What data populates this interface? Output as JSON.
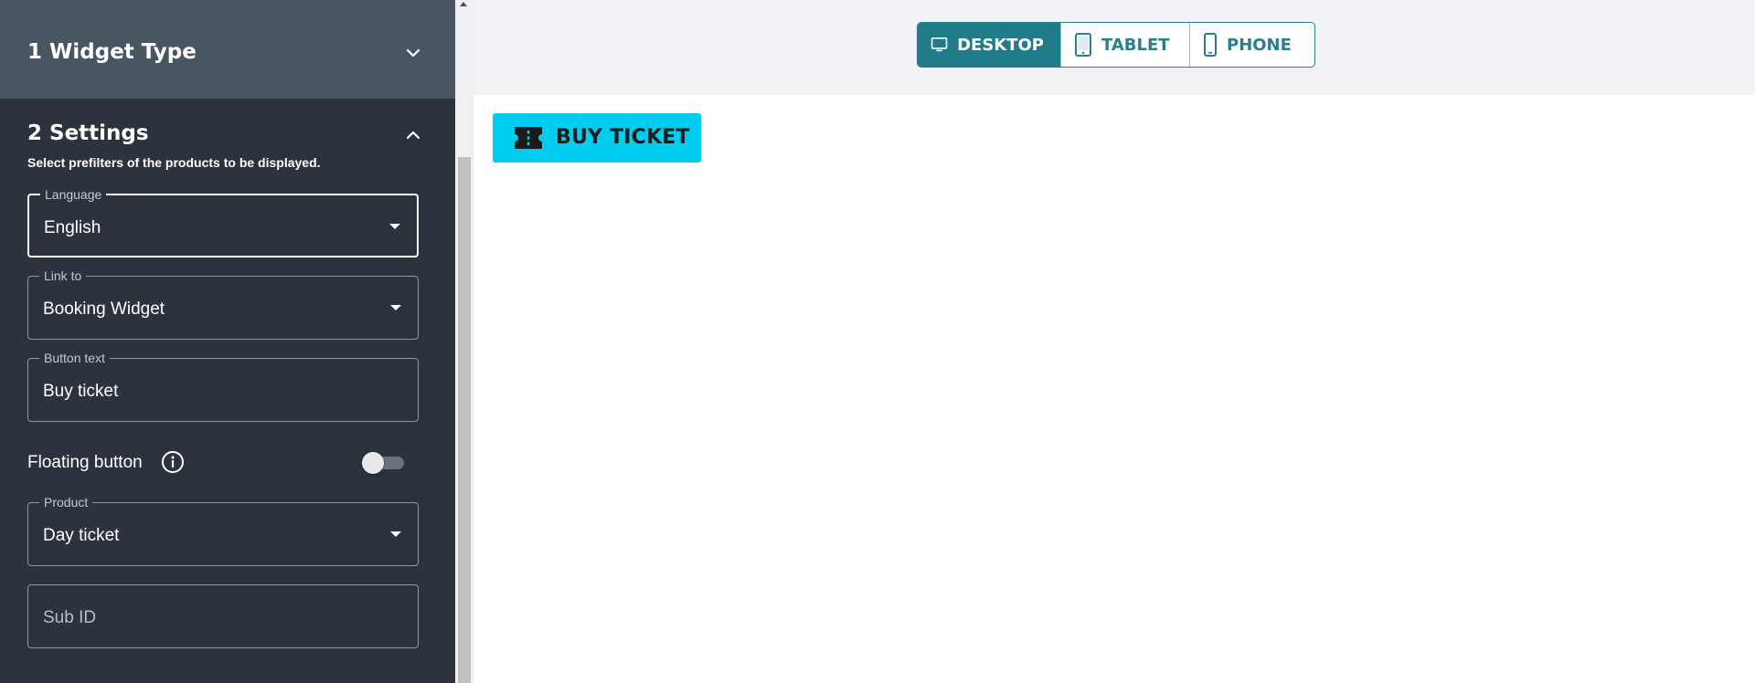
{
  "sidebar": {
    "section1": {
      "title": "1 Widget Type"
    },
    "section2": {
      "title": "2 Settings",
      "subtitle": "Select prefilters of the products to be displayed."
    },
    "fields": {
      "language": {
        "label": "Language",
        "value": "English"
      },
      "link_to": {
        "label": "Link to",
        "value": "Booking Widget"
      },
      "button_text": {
        "label": "Button text",
        "value": "Buy ticket"
      },
      "product": {
        "label": "Product",
        "value": "Day ticket"
      },
      "sub_id": {
        "placeholder": "Sub ID"
      }
    },
    "floating": {
      "label": "Floating button",
      "enabled": false
    }
  },
  "devices": {
    "desktop": "DESKTOP",
    "tablet": "TABLET",
    "phone": "PHONE",
    "active": "desktop"
  },
  "preview": {
    "button_label": "BUY TICKET"
  },
  "colors": {
    "sidebar_bg": "#2d333c",
    "section_header_bg": "#4a5562",
    "accent_teal": "#217c8a",
    "buy_button_bg": "#00ccf0"
  },
  "icons": {
    "section1_chevron": "chevron-down-icon",
    "section2_chevron": "chevron-up-icon",
    "floating_info": "info-icon",
    "desktop": "monitor-icon",
    "tablet": "tablet-icon",
    "phone": "phone-icon",
    "buy_button": "ticket-icon"
  }
}
